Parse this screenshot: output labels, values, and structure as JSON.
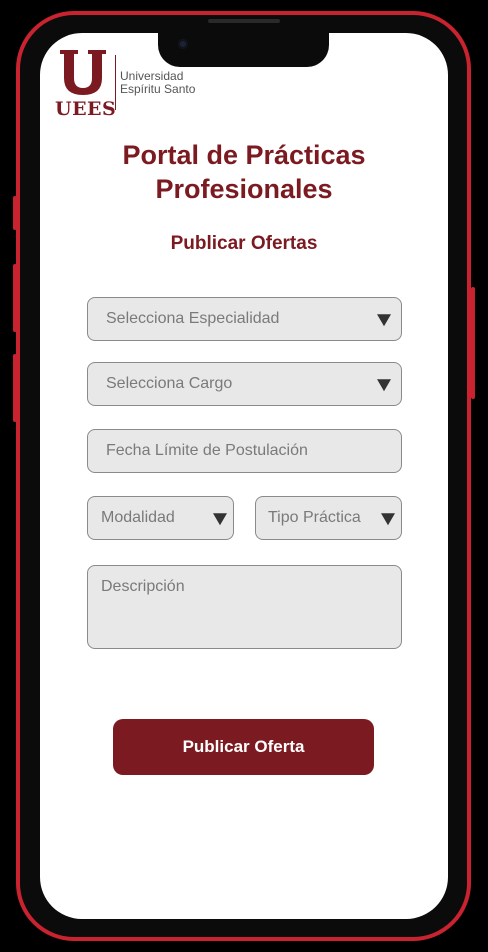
{
  "brand": {
    "logo_letter": "U",
    "logo_abbrev": "UEES",
    "name_line1": "Universidad",
    "name_line2": "Espíritu Santo",
    "primary_color": "#7b1a20",
    "frame_color": "#c8232f"
  },
  "header": {
    "title_line1": "Portal de Prácticas",
    "title_line2": "Profesionales",
    "subtitle": "Publicar Ofertas"
  },
  "form": {
    "especialidad": {
      "label": "Selecciona Especialidad",
      "icon": "caret-down-icon"
    },
    "cargo": {
      "label": "Selecciona Cargo",
      "icon": "caret-down-icon"
    },
    "fecha": {
      "placeholder": "Fecha Límite de Postulación"
    },
    "modalidad": {
      "label": "Modalidad",
      "icon": "caret-down-icon"
    },
    "tipo_practica": {
      "label": "Tipo Práctica",
      "icon": "caret-down-icon"
    },
    "descripcion": {
      "placeholder": "Descripción"
    },
    "submit_label": "Publicar Oferta"
  }
}
